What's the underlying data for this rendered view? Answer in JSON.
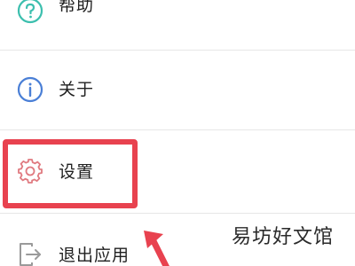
{
  "menu": {
    "items": [
      {
        "label": "帮助",
        "icon": "help-circle-icon"
      },
      {
        "label": "关于",
        "icon": "info-circle-icon"
      },
      {
        "label": "设置",
        "icon": "gear-icon"
      },
      {
        "label": "退出应用",
        "icon": "exit-app-icon"
      }
    ]
  },
  "annotation": {
    "highlight_color": "#e8424f",
    "highlighted_item": "设置"
  },
  "watermark": {
    "text": "易坊好文馆"
  },
  "colors": {
    "help_icon": "#3cbfae",
    "about_icon": "#4a7fd6",
    "settings_icon": "#e07a80",
    "exit_icon": "#9a9a9a",
    "divider": "#e6e6e6"
  }
}
